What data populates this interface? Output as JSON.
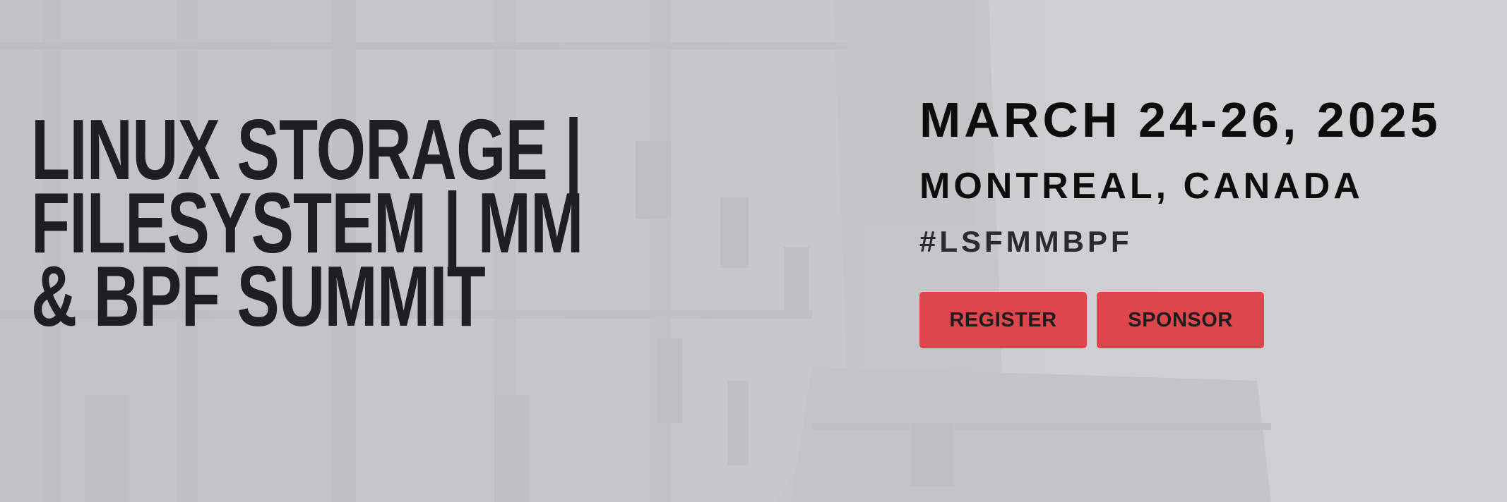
{
  "hero": {
    "title_lines": [
      "LINUX STORAGE |",
      "FILESYSTEM | MM",
      "& BPF SUMMIT"
    ],
    "date": "MARCH 24-26, 2025",
    "location": "MONTREAL, CANADA",
    "hashtag": "#LSFMMBPF",
    "buttons": {
      "register_label": "REGISTER",
      "sponsor_label": "SPONSOR"
    },
    "background_image": "grayscale-historic-building-photo"
  },
  "colors": {
    "accent": "#dd464b",
    "title_text": "#1f1e20",
    "info_text": "#0d0d0e",
    "background": "#c9c9cb"
  }
}
